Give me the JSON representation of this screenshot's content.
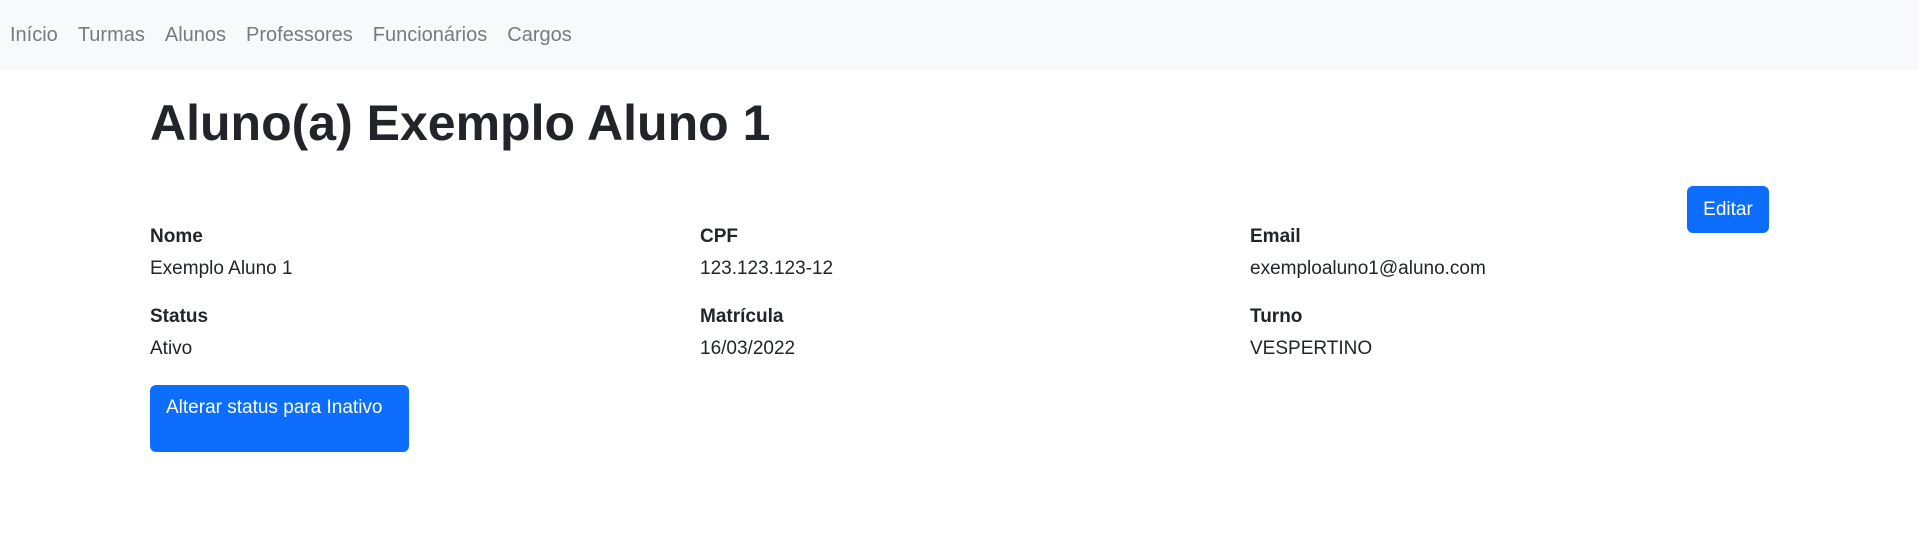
{
  "nav": {
    "items": [
      "Início",
      "Turmas",
      "Alunos",
      "Professores",
      "Funcionários",
      "Cargos"
    ]
  },
  "page": {
    "title": "Aluno(a) Exemplo Aluno 1",
    "edit_label": "Editar"
  },
  "fields": [
    {
      "label": "Nome",
      "value": "Exemplo Aluno 1"
    },
    {
      "label": "CPF",
      "value": "123.123.123-12"
    },
    {
      "label": "Email",
      "value": "exemploaluno1@aluno.com"
    },
    {
      "label": "Status",
      "value": "Ativo"
    },
    {
      "label": "Matrícula",
      "value": "16/03/2022"
    },
    {
      "label": "Turno",
      "value": "VESPERTINO"
    }
  ],
  "actions": {
    "status_label": "Alterar status para Inativo"
  },
  "colors": {
    "primary": "#0d6efd",
    "navbar_bg": "#f8f9fa",
    "nav_text": "#757b81"
  }
}
